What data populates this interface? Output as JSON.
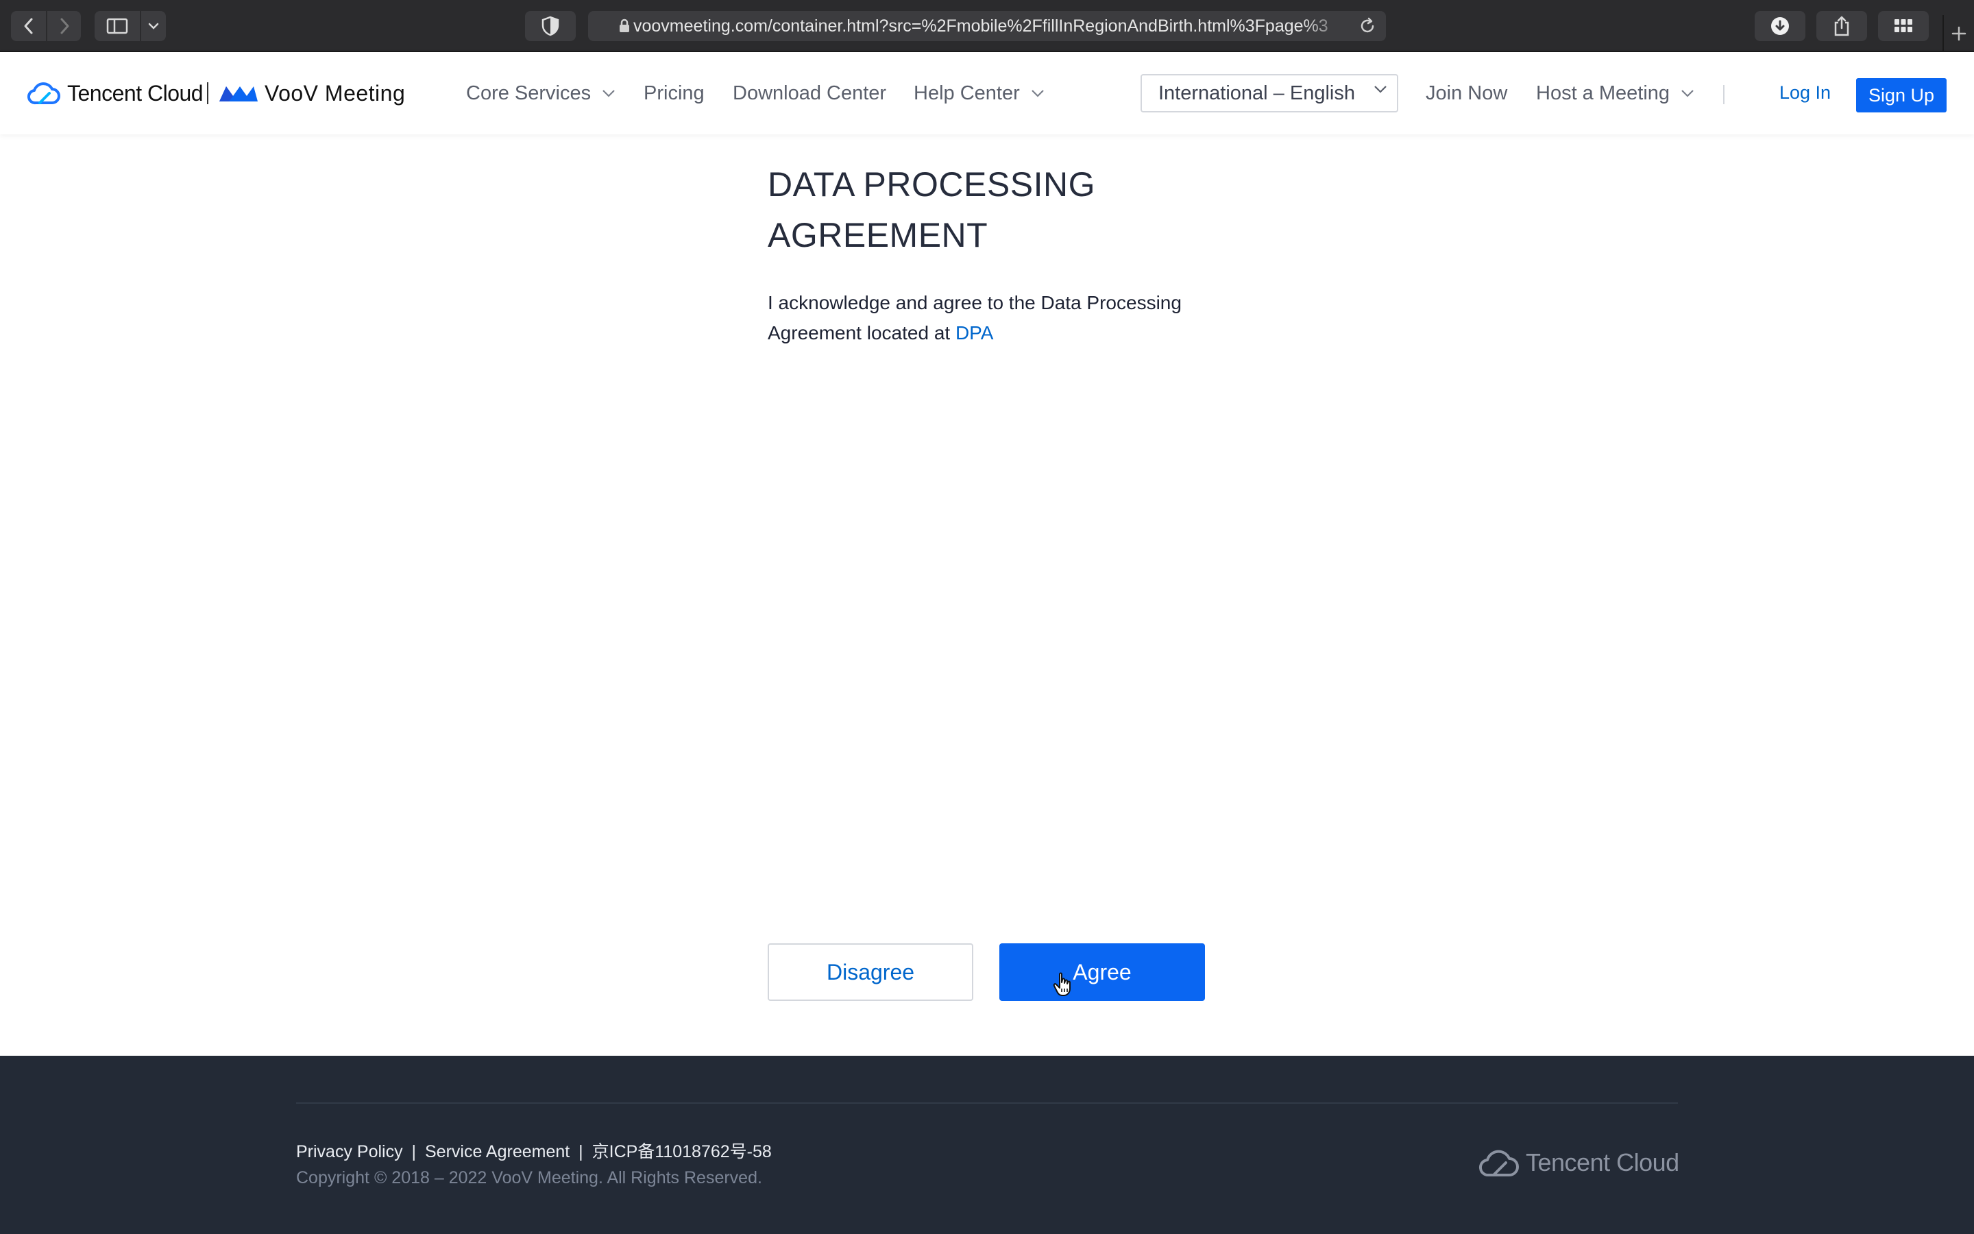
{
  "browser": {
    "url": "voovmeeting.com/container.html?src=%2Fmobile%2FfillInRegionAndBirth.html%3Fpage%3"
  },
  "header": {
    "logo_tencent": "Tencent Cloud",
    "logo_voov": "VooV Meeting",
    "nav": {
      "core_services": "Core Services",
      "pricing": "Pricing",
      "download_center": "Download Center",
      "help_center": "Help Center"
    },
    "language": "International – English",
    "join_now": "Join Now",
    "host_meeting": "Host a Meeting",
    "login": "Log In",
    "signup": "Sign Up",
    "brand_color": "#0a66f2"
  },
  "main": {
    "title_line1": "DATA PROCESSING",
    "title_line2": "AGREEMENT",
    "desc_line1": "I acknowledge and agree to the Data Processing",
    "desc_line2_prefix": "Agreement located at",
    "desc_link": "DPA",
    "disagree": "Disagree",
    "agree": "Agree"
  },
  "footer": {
    "privacy_policy": "Privacy Policy",
    "service_agreement": "Service Agreement",
    "icp": "京ICP备11018762号-58",
    "separator": "|",
    "copyright": "Copyright © 2018 – 2022 VooV Meeting. All Rights Reserved.",
    "logo": "Tencent Cloud"
  }
}
